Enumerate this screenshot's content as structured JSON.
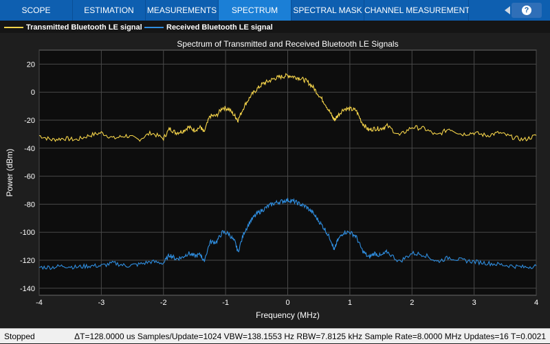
{
  "tabs": [
    {
      "label": "SCOPE",
      "active": false
    },
    {
      "label": "ESTIMATION",
      "active": false
    },
    {
      "label": "MEASUREMENTS",
      "active": false
    },
    {
      "label": "SPECTRUM",
      "active": true
    },
    {
      "label": "SPECTRAL MASK",
      "active": false
    },
    {
      "label": "CHANNEL MEASUREMENTS",
      "active": false
    }
  ],
  "help_icon": {
    "icon": "help-icon",
    "glyph": "?"
  },
  "legend": {
    "items": [
      {
        "label": "Transmitted Bluetooth LE signal",
        "color": "#f5d44a"
      },
      {
        "label": "Received Bluetooth LE signal",
        "color": "#2f8ee0"
      }
    ]
  },
  "chart_data": {
    "type": "line",
    "title": "Spectrum of Transmitted and Received Bluetooth LE Signals",
    "xlabel": "Frequency (MHz)",
    "ylabel": "Power (dBm)",
    "xlim": [
      -4,
      4
    ],
    "ylim": [
      -145,
      30
    ],
    "xticks": [
      -4,
      -3,
      -2,
      -1,
      0,
      1,
      2,
      3,
      4
    ],
    "yticks": [
      20,
      0,
      -20,
      -40,
      -60,
      -80,
      -100,
      -120,
      -140
    ],
    "grid": true,
    "background": "#0d0d0d",
    "grid_color": "#4a4a4a",
    "series": [
      {
        "name": "Transmitted Bluetooth LE signal",
        "color": "#f5d44a",
        "x": [
          -4,
          -3.8,
          -3.6,
          -3.4,
          -3.2,
          -3.0,
          -2.8,
          -2.6,
          -2.4,
          -2.2,
          -2.0,
          -1.9,
          -1.8,
          -1.7,
          -1.6,
          -1.5,
          -1.4,
          -1.35,
          -1.25,
          -1.15,
          -1.05,
          -0.95,
          -0.85,
          -0.8,
          -0.7,
          -0.6,
          -0.5,
          -0.4,
          -0.3,
          -0.2,
          -0.1,
          0.0,
          0.1,
          0.2,
          0.3,
          0.4,
          0.5,
          0.6,
          0.7,
          0.75,
          0.8,
          0.9,
          1.0,
          1.1,
          1.2,
          1.3,
          1.4,
          1.5,
          1.6,
          1.8,
          2.0,
          2.2,
          2.4,
          2.6,
          2.8,
          3.0,
          3.2,
          3.4,
          3.6,
          3.8,
          4.0
        ],
        "y": [
          -31,
          -34,
          -33,
          -34,
          -31,
          -29,
          -33,
          -31,
          -34,
          -29,
          -33,
          -26,
          -29,
          -28,
          -25,
          -27,
          -25,
          -29,
          -17,
          -17,
          -11,
          -12,
          -17,
          -20,
          -10,
          -3,
          2,
          6,
          8,
          10,
          11,
          12,
          11,
          10,
          8,
          4,
          -2,
          -8,
          -16,
          -20,
          -17,
          -12,
          -12,
          -13,
          -22,
          -27,
          -26,
          -26,
          -24,
          -31,
          -25,
          -26,
          -31,
          -26,
          -30,
          -29,
          -31,
          -29,
          -32,
          -34,
          -31
        ]
      },
      {
        "name": "Received Bluetooth LE signal",
        "color": "#2f8ee0",
        "x": [
          -4,
          -3.8,
          -3.6,
          -3.4,
          -3.2,
          -3.0,
          -2.8,
          -2.6,
          -2.4,
          -2.2,
          -2.0,
          -1.9,
          -1.8,
          -1.7,
          -1.6,
          -1.5,
          -1.4,
          -1.35,
          -1.25,
          -1.15,
          -1.05,
          -0.95,
          -0.85,
          -0.8,
          -0.7,
          -0.6,
          -0.5,
          -0.4,
          -0.3,
          -0.2,
          -0.1,
          0.0,
          0.1,
          0.2,
          0.3,
          0.4,
          0.5,
          0.6,
          0.7,
          0.75,
          0.8,
          0.9,
          1.0,
          1.1,
          1.2,
          1.3,
          1.4,
          1.5,
          1.6,
          1.8,
          2.0,
          2.2,
          2.4,
          2.6,
          2.8,
          3.0,
          3.2,
          3.4,
          3.6,
          3.8,
          4.0
        ],
        "y": [
          -125,
          -125,
          -124,
          -125,
          -124,
          -124,
          -122,
          -124,
          -123,
          -121,
          -122,
          -116,
          -119,
          -118,
          -115,
          -117,
          -116,
          -121,
          -107,
          -107,
          -100,
          -101,
          -107,
          -114,
          -100,
          -92,
          -87,
          -84,
          -81,
          -79,
          -78,
          -77,
          -78,
          -80,
          -82,
          -86,
          -92,
          -98,
          -106,
          -113,
          -106,
          -100,
          -100,
          -103,
          -113,
          -118,
          -115,
          -117,
          -114,
          -121,
          -115,
          -116,
          -121,
          -118,
          -120,
          -121,
          -122,
          -123,
          -124,
          -125,
          -124
        ]
      }
    ]
  },
  "status": {
    "state": "Stopped",
    "info": "ΔT=128.0000 us  Samples/Update=1024  VBW=138.1553 Hz  RBW=7.8125 kHz  Sample Rate=8.0000 MHz  Updates=16  T=0.0021"
  }
}
